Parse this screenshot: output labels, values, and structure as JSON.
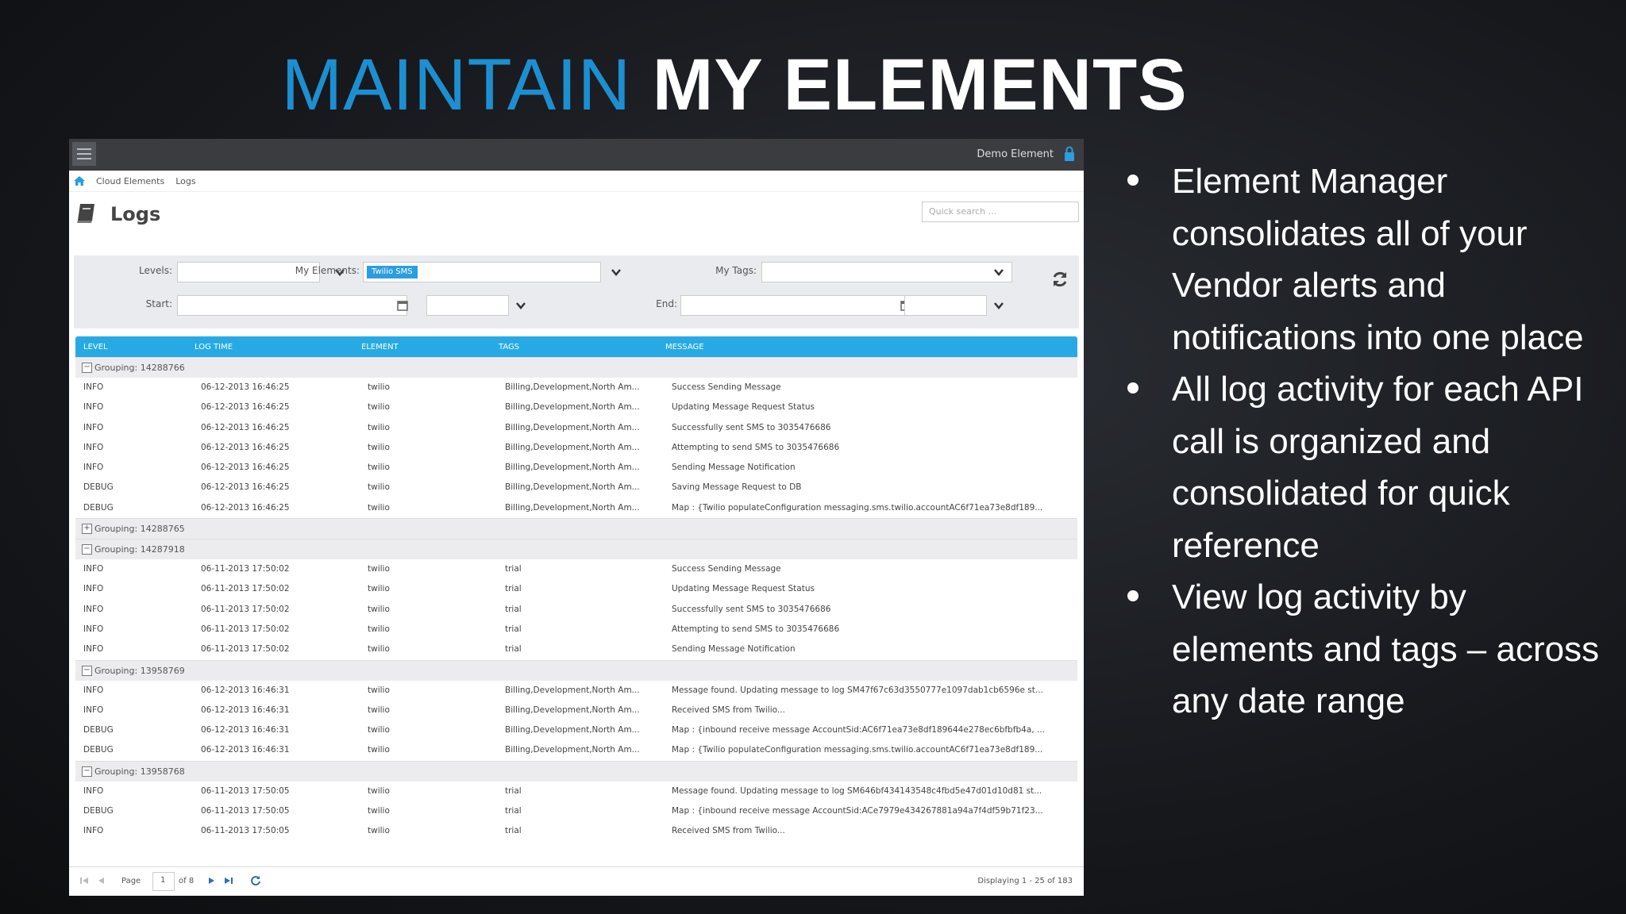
{
  "slide": {
    "title_part1": "MAINTAIN",
    "title_part2": "MY ELEMENTS",
    "bullets": [
      "Element Manager consolidates all of your Vendor alerts and notifications into one place",
      "All  log activity for each API call is organized and consolidated for quick reference",
      "View log activity by elements and tags – across any date range"
    ]
  },
  "app": {
    "user_label": "Demo Element",
    "breadcrumb": [
      "Cloud Elements",
      "Logs"
    ],
    "page_title": "Logs",
    "search_placeholder": "Quick search ...",
    "filters": {
      "levels_label": "Levels:",
      "my_elements_label": "My Elements:",
      "my_elements_chip": "Twilio SMS",
      "my_tags_label": "My Tags:",
      "start_label": "Start:",
      "end_label": "End:"
    },
    "columns": [
      "LEVEL",
      "LOG TIME",
      "ELEMENT",
      "TAGS",
      "MESSAGE"
    ],
    "groups": [
      {
        "label": "Grouping: 14288766",
        "expanded": true,
        "rows": [
          [
            "INFO",
            "06-12-2013 16:46:25",
            "twilio",
            "Billing,Development,North Am...",
            "Success Sending Message"
          ],
          [
            "INFO",
            "06-12-2013 16:46:25",
            "twilio",
            "Billing,Development,North Am...",
            "Updating Message Request Status"
          ],
          [
            "INFO",
            "06-12-2013 16:46:25",
            "twilio",
            "Billing,Development,North Am...",
            "Successfully sent SMS to 3035476686"
          ],
          [
            "INFO",
            "06-12-2013 16:46:25",
            "twilio",
            "Billing,Development,North Am...",
            "Attempting to send SMS to 3035476686"
          ],
          [
            "INFO",
            "06-12-2013 16:46:25",
            "twilio",
            "Billing,Development,North Am...",
            "Sending Message Notification"
          ],
          [
            "DEBUG",
            "06-12-2013 16:46:25",
            "twilio",
            "Billing,Development,North Am...",
            "Saving Message Request to DB"
          ],
          [
            "DEBUG",
            "06-12-2013 16:46:25",
            "twilio",
            "Billing,Development,North Am...",
            "Map : {Twilio populateConfiguration messaging.sms.twilio.accountAC6f71ea73e8df189..."
          ]
        ]
      },
      {
        "label": "Grouping: 14288765",
        "expanded": false,
        "rows": []
      },
      {
        "label": "Grouping: 14287918",
        "expanded": true,
        "rows": [
          [
            "INFO",
            "06-11-2013 17:50:02",
            "twilio",
            "trial",
            "Success Sending Message"
          ],
          [
            "INFO",
            "06-11-2013 17:50:02",
            "twilio",
            "trial",
            "Updating Message Request Status"
          ],
          [
            "INFO",
            "06-11-2013 17:50:02",
            "twilio",
            "trial",
            "Successfully sent SMS to 3035476686"
          ],
          [
            "INFO",
            "06-11-2013 17:50:02",
            "twilio",
            "trial",
            "Attempting to send SMS to 3035476686"
          ],
          [
            "INFO",
            "06-11-2013 17:50:02",
            "twilio",
            "trial",
            "Sending Message Notification"
          ]
        ]
      },
      {
        "label": "Grouping: 13958769",
        "expanded": true,
        "rows": [
          [
            "INFO",
            "06-12-2013 16:46:31",
            "twilio",
            "Billing,Development,North Am...",
            "Message found. Updating message to log SM47f67c63d3550777e1097dab1cb6596e st..."
          ],
          [
            "INFO",
            "06-12-2013 16:46:31",
            "twilio",
            "Billing,Development,North Am...",
            "Received SMS from Twilio..."
          ],
          [
            "DEBUG",
            "06-12-2013 16:46:31",
            "twilio",
            "Billing,Development,North Am...",
            "Map : {inbound receive message AccountSid:AC6f71ea73e8df189644e278ec6bfbfb4a, ..."
          ],
          [
            "DEBUG",
            "06-12-2013 16:46:31",
            "twilio",
            "Billing,Development,North Am...",
            "Map : {Twilio populateConfiguration messaging.sms.twilio.accountAC6f71ea73e8df189..."
          ]
        ]
      },
      {
        "label": "Grouping: 13958768",
        "expanded": true,
        "rows": [
          [
            "INFO",
            "06-11-2013 17:50:05",
            "twilio",
            "trial",
            "Message found. Updating message to log SM646bf434143548c4fbd5e47d01d10d81 st..."
          ],
          [
            "DEBUG",
            "06-11-2013 17:50:05",
            "twilio",
            "trial",
            "Map : {inbound receive message AccountSid:ACe7979e434267881a94a7f4df59b71f23..."
          ],
          [
            "INFO",
            "06-11-2013 17:50:05",
            "twilio",
            "trial",
            "Received SMS from Twilio..."
          ]
        ]
      }
    ],
    "pager": {
      "page_label": "Page",
      "page_value": "1",
      "of_label": "of 8",
      "display_text": "Displaying 1 - 25 of 183"
    }
  }
}
